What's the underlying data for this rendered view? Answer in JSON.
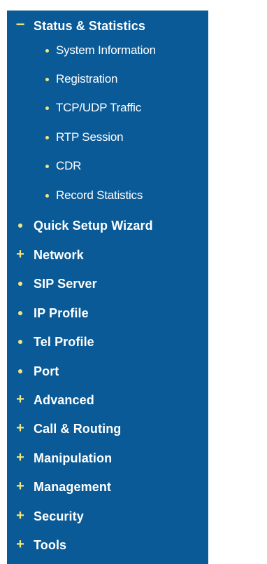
{
  "nav": {
    "expanded": {
      "label": "Status & Statistics",
      "marker": "−",
      "sub_items": [
        {
          "label": "System Information"
        },
        {
          "label": "Registration"
        },
        {
          "label": "TCP/UDP Traffic"
        },
        {
          "label": "RTP Session"
        },
        {
          "label": "CDR"
        },
        {
          "label": "Record Statistics"
        }
      ]
    },
    "items": [
      {
        "label": "Quick Setup Wizard",
        "marker": "dot"
      },
      {
        "label": "Network",
        "marker": "+"
      },
      {
        "label": "SIP Server",
        "marker": "dot"
      },
      {
        "label": "IP Profile",
        "marker": "dot"
      },
      {
        "label": "Tel Profile",
        "marker": "dot"
      },
      {
        "label": "Port",
        "marker": "dot"
      },
      {
        "label": "Advanced",
        "marker": "+"
      },
      {
        "label": "Call & Routing",
        "marker": "+"
      },
      {
        "label": "Manipulation",
        "marker": "+"
      },
      {
        "label": "Management",
        "marker": "+"
      },
      {
        "label": "Security",
        "marker": "+"
      },
      {
        "label": "Tools",
        "marker": "+"
      }
    ]
  },
  "colors": {
    "panel": "#0a5a97",
    "marker": "#f2e77a",
    "text": "#ffffff"
  }
}
